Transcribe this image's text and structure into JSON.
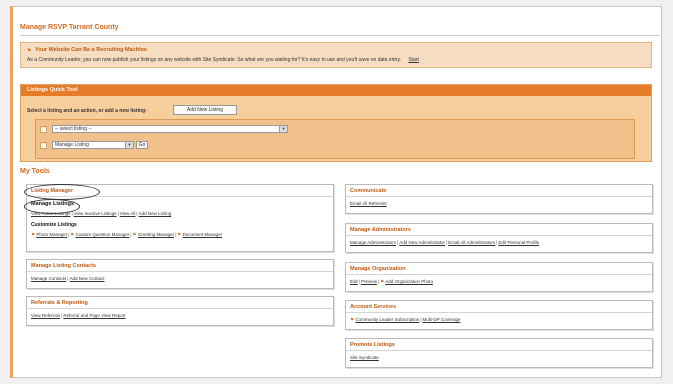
{
  "page": {
    "title": "Manage RSVP Tarrant County"
  },
  "notice": {
    "heading": "Your Website Can Be a Recruiting Machine",
    "text": "As a Community Leader, you can now publish your listings on any website with Site Syndicate. So what are you waiting for? It's easy to use and you'll save on data entry.",
    "link": "Start"
  },
  "quick_tool": {
    "header": "Listings Quick Tool",
    "prompt": "Select a listing and an action, or add a new listing:",
    "add_button": "Add New Listing",
    "listing_select": "-- select listing --",
    "action_select": "Manage Listing",
    "go_button": "Go"
  },
  "my_tools": {
    "heading": "My Tools",
    "listing_manager": {
      "title": "Listing Manager",
      "manage_listings": "Manage Listings",
      "links": [
        "View Active Listings",
        "View Inactive Listings",
        "View All",
        "Add New Listing"
      ],
      "customize_title": "Customize Listings",
      "customize_links": [
        "Photo Manager",
        "Custom Question Manager",
        "Greeting Manager",
        "Document Manager"
      ]
    },
    "listing_contacts": {
      "title": "Manage Listing Contacts",
      "links": [
        "Manage Contacts",
        "Add New Contact"
      ]
    },
    "referrals": {
      "title": "Referrals & Reporting",
      "links": [
        "View Referrals",
        "Referral and Page View Report"
      ]
    },
    "communicate": {
      "title": "Communicate",
      "links": [
        "Email All Referrals"
      ]
    },
    "administrators": {
      "title": "Manage Administrators",
      "links": [
        "Manage Administrators",
        "Add New Administrator",
        "Email All Administrators",
        "Edit Personal Profile"
      ]
    },
    "organization": {
      "title": "Manage Organization",
      "links": [
        "Edit",
        "Preview",
        "Add Organization Photo"
      ]
    },
    "account": {
      "title": "Account Services",
      "links": [
        "Community Leader Subscription",
        "Multi-DP Coverage"
      ]
    },
    "promote": {
      "title": "Promote Listings",
      "links": [
        "Site Syndicate"
      ]
    }
  },
  "colors": {
    "accent": "#e67c2a",
    "notice_bg": "#f6dcc0",
    "tool_bg": "#f7cf9d"
  }
}
